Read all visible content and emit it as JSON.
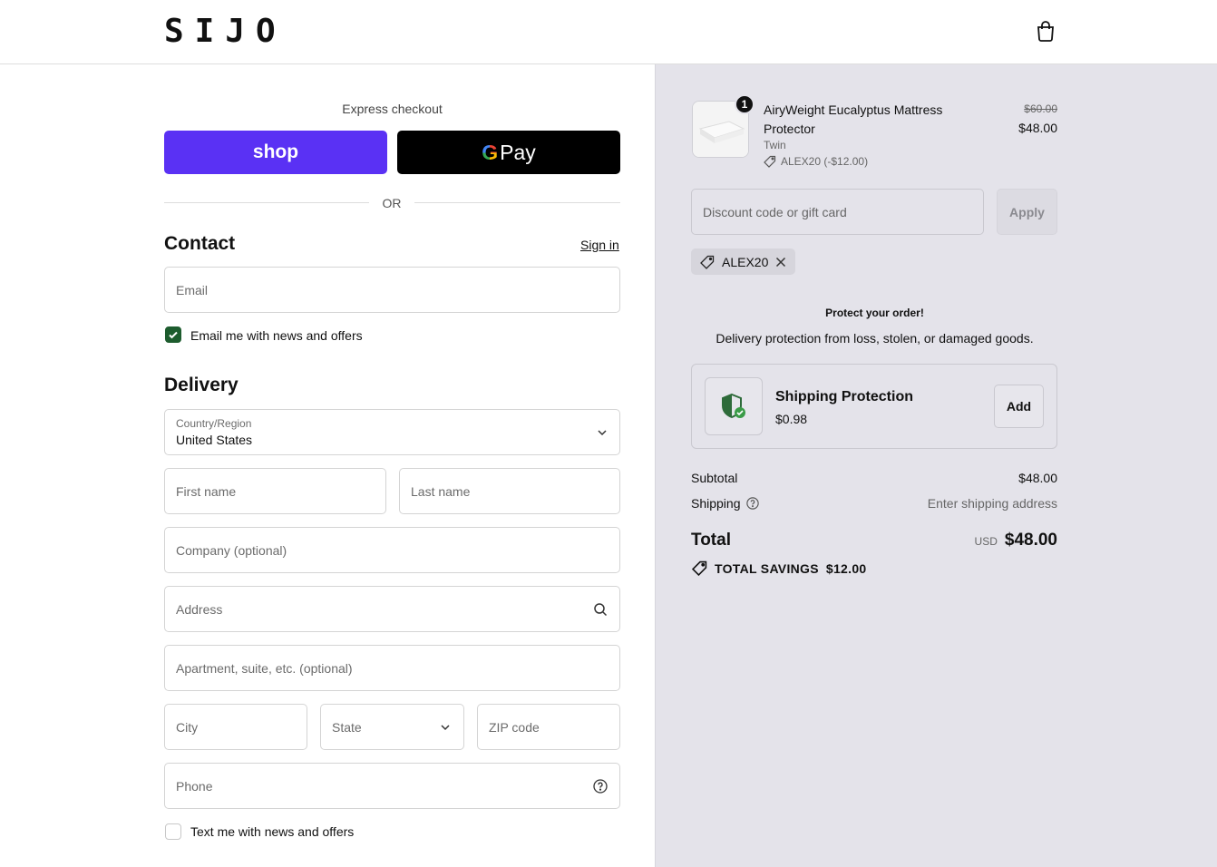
{
  "header": {
    "logo": "SIJO",
    "cart_icon": "shopping-bag-icon"
  },
  "express": {
    "label": "Express checkout",
    "shop_label": "shop",
    "gpay_g": "G",
    "gpay_label": "Pay",
    "or_label": "OR"
  },
  "contact": {
    "title": "Contact",
    "signin_label": "Sign in",
    "email_placeholder": "Email",
    "newsletter_label": "Email me with news and offers",
    "newsletter_checked": true
  },
  "delivery": {
    "title": "Delivery",
    "country_label": "Country/Region",
    "country_value": "United States",
    "first_name_placeholder": "First name",
    "last_name_placeholder": "Last name",
    "company_placeholder": "Company (optional)",
    "address_placeholder": "Address",
    "apartment_placeholder": "Apartment, suite, etc. (optional)",
    "city_placeholder": "City",
    "state_placeholder": "State",
    "zip_placeholder": "ZIP code",
    "phone_placeholder": "Phone",
    "sms_label": "Text me with news and offers",
    "sms_checked": false
  },
  "summary": {
    "product": {
      "quantity": "1",
      "name": "AiryWeight Eucalyptus Mattress Protector",
      "variant": "Twin",
      "discount": "ALEX20 (-$12.00)",
      "price_old": "$60.00",
      "price_new": "$48.00"
    },
    "discount_placeholder": "Discount code or gift card",
    "apply_label": "Apply",
    "applied_code": "ALEX20",
    "protect_title": "Protect your order!",
    "protect_desc": "Delivery protection from loss, stolen, or damaged goods.",
    "protection_name": "Shipping Protection",
    "protection_price": "$0.98",
    "add_label": "Add",
    "subtotal_label": "Subtotal",
    "subtotal_value": "$48.00",
    "shipping_label": "Shipping",
    "shipping_value": "Enter shipping address",
    "total_label": "Total",
    "total_currency": "USD",
    "total_value": "$48.00",
    "savings_label": "TOTAL SAVINGS",
    "savings_value": "$12.00"
  },
  "colors": {
    "shop_purple": "#5a31f4",
    "check_green": "#1d5c2e",
    "summary_bg": "#e4e3ea"
  }
}
